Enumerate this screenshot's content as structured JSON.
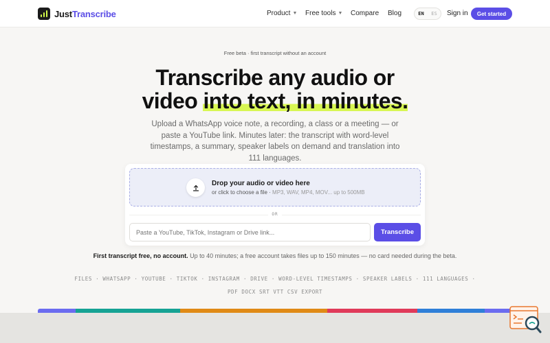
{
  "brand": {
    "name_part1": "Just",
    "name_part2": "Transcribe"
  },
  "nav": {
    "product": "Product",
    "free_tools": "Free tools",
    "compare": "Compare",
    "blog": "Blog",
    "lang_en": "EN",
    "lang_es": "ES",
    "signin": "Sign in",
    "cta": "Get started"
  },
  "hero": {
    "eyebrow": "Free beta · first transcript without an account",
    "headline_line1": "Transcribe any audio or",
    "headline_pre": "video ",
    "headline_highlight": "into text, in minutes.",
    "subcopy": "Upload a WhatsApp voice note, a recording, a class or a meeting — or paste a YouTube link. Minutes later: the transcript with word-level timestamps, a summary, speaker labels on demand and translation into 111 languages."
  },
  "upload": {
    "drop_title": "Drop your audio or video here",
    "drop_sub": "or click to choose a file ·",
    "drop_formats": "MP3, WAV, MP4, MOV... up to 500MB",
    "or_label": "OR",
    "link_placeholder": "Paste a YouTube, TikTok, Instagram or Drive link...",
    "transcribe_label": "Transcribe"
  },
  "note": {
    "bold": "First transcript free, no account.",
    "rest": " Up to 40 minutes; a free account takes files up to 150 minutes — no card needed during the beta."
  },
  "formats": {
    "line1": "FILES · WHATSAPP · YOUTUBE · TIKTOK · INSTAGRAM · DRIVE  ·  WORD-LEVEL TIMESTAMPS  ·  SPEAKER LABELS  ·  111 LANGUAGES  ·",
    "line2": "PDF DOCX SRT VTT CSV EXPORT"
  },
  "colors": {
    "accent": "#5b4ee6",
    "highlight": "#d8f653",
    "stripe": [
      "#6b6cf0",
      "#16a394",
      "#e08a16",
      "#e03a5a",
      "#2f7fd8",
      "#6b6cf0"
    ]
  },
  "icons": {
    "logo": "bars-icon",
    "upload": "upload-arrow-icon",
    "widget": "search-chat-icon"
  }
}
